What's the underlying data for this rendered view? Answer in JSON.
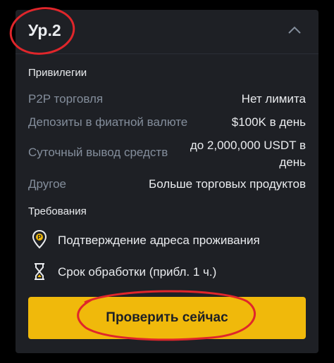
{
  "level": {
    "title": "Ур.2"
  },
  "privileges": {
    "heading": "Привилегии",
    "rows": [
      {
        "label": "P2P торговля",
        "value": "Нет лимита"
      },
      {
        "label": "Депозиты в фиатной валюте",
        "value": "$100K в день"
      },
      {
        "label": "Суточный вывод средств",
        "value": "до 2,000,000 USDT в день"
      },
      {
        "label": "Другое",
        "value": "Больше торговых продуктов"
      }
    ]
  },
  "requirements": {
    "heading": "Требования",
    "items": [
      {
        "icon": "location-pin-icon",
        "text": "Подтверждение адреса проживания"
      },
      {
        "icon": "hourglass-icon",
        "text": "Срок обработки (прибл. 1 ч.)"
      }
    ]
  },
  "actions": {
    "verify_label": "Проверить сейчас"
  },
  "icons": {
    "collapse": "chevron-up-icon"
  },
  "colors": {
    "accent": "#f0b90b",
    "card_bg": "#1e2025",
    "text_primary": "#eaecef",
    "text_secondary": "#848e9c",
    "annotation": "#e0262b"
  }
}
